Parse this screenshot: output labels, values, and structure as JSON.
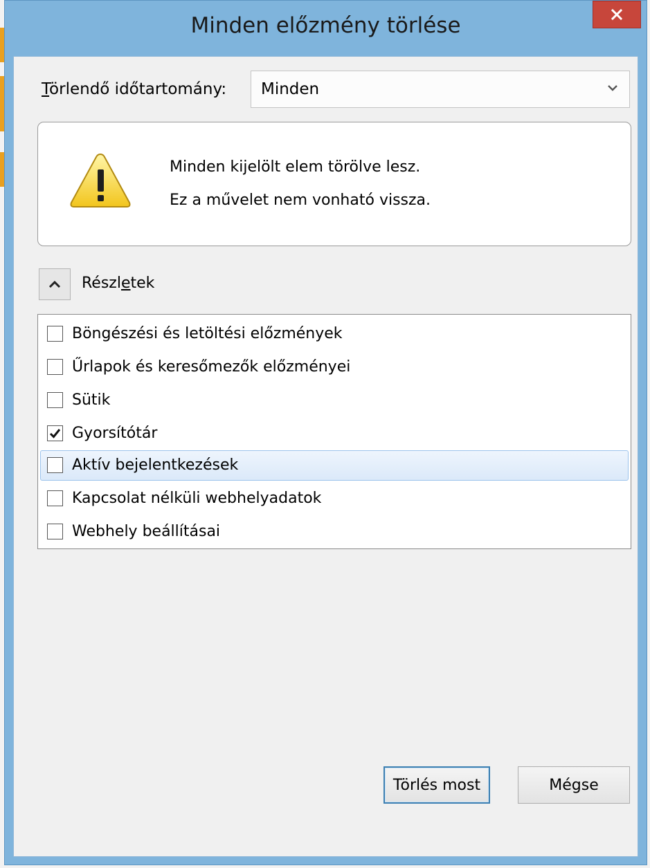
{
  "window": {
    "title": "Minden előzmény törlése"
  },
  "range": {
    "label_prefix": "T",
    "label_rest": "örlendő időtartomány:",
    "selected": "Minden"
  },
  "warning": {
    "line1": "Minden kijelölt elem törölve lesz.",
    "line2": "Ez a művelet nem vonható vissza."
  },
  "details": {
    "label_part1": "Részl",
    "label_part2": "e",
    "label_part3": "tek",
    "expanded": true
  },
  "items": [
    {
      "label": "Böngészési és letöltési előzmények",
      "checked": false
    },
    {
      "label": "Űrlapok és keresőmezők előzményei",
      "checked": false
    },
    {
      "label": "Sütik",
      "checked": false
    },
    {
      "label": "Gyorsítótár",
      "checked": true
    },
    {
      "label": "Aktív bejelentkezések",
      "checked": false
    },
    {
      "label": "Kapcsolat nélküli webhelyadatok",
      "checked": false
    },
    {
      "label": "Webhely beállításai",
      "checked": false
    }
  ],
  "buttons": {
    "clear_now": "Törlés most",
    "cancel": "Mégse"
  },
  "colors": {
    "window_frame": "#7fb4dc",
    "close_button": "#c7463b",
    "hover_row": "#dbe9f9"
  }
}
